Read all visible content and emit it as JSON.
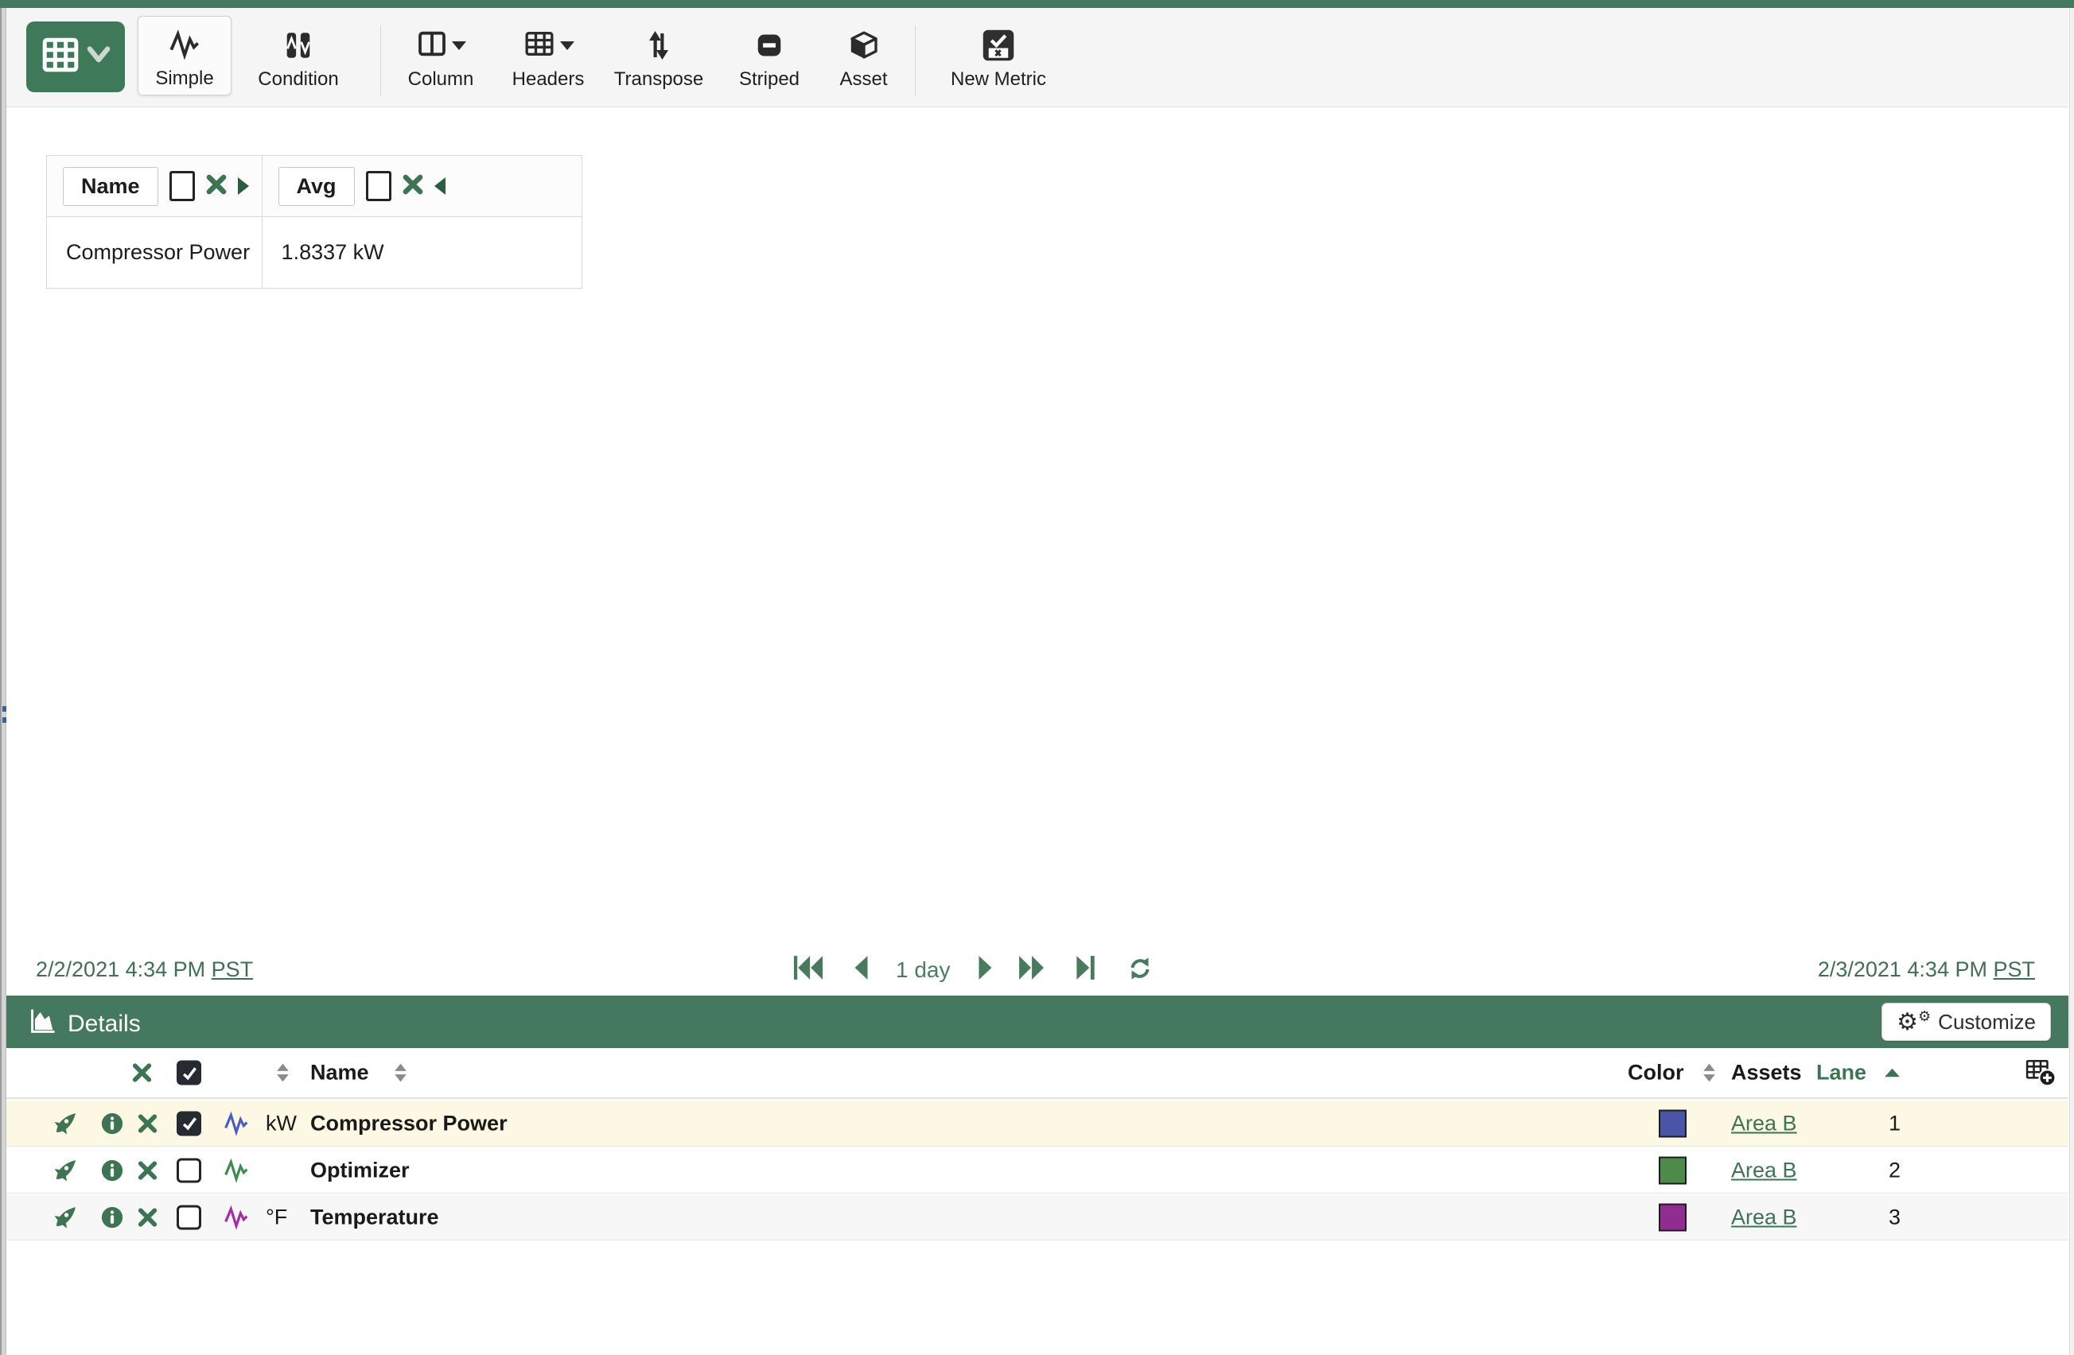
{
  "colors": {
    "brand_green": "#45795f",
    "button_green": "#3e7a5a",
    "icon_green": "#3c7454",
    "date_green": "#3f6f57",
    "selected_row_bg": "#fcf8e3",
    "swatch_compressor_power": "#4a55a8",
    "swatch_optimizer": "#4d8b4b",
    "swatch_temperature": "#912d91",
    "signal_compressor_power": "#4b5cc4",
    "signal_optimizer": "#3e8a4d",
    "signal_temperature": "#a62ba6"
  },
  "toolbar": {
    "buttons": {
      "simple": "Simple",
      "condition": "Condition",
      "column": "Column",
      "headers": "Headers",
      "transpose": "Transpose",
      "striped": "Striped",
      "asset": "Asset",
      "new_metric": "New Metric"
    }
  },
  "summary_table": {
    "name_header": "Name",
    "avg_header": "Avg",
    "rows": [
      {
        "name": "Compressor Power",
        "avg": "1.8337 kW"
      }
    ]
  },
  "timebar": {
    "start": "2/2/2021 4:34 PM",
    "start_tz": "PST",
    "duration": "1 day",
    "end": "2/3/2021 4:34 PM",
    "end_tz": "PST"
  },
  "details": {
    "title": "Details",
    "customize": "Customize",
    "header": {
      "name": "Name",
      "color": "Color",
      "assets": "Assets",
      "lane": "Lane"
    },
    "rows": [
      {
        "unit": "kW",
        "name": "Compressor Power",
        "asset": "Area B",
        "lane": "1",
        "selected": true,
        "checked": true
      },
      {
        "unit": "",
        "name": "Optimizer",
        "asset": "Area B",
        "lane": "2",
        "selected": false,
        "checked": false
      },
      {
        "unit": "°F",
        "name": "Temperature",
        "asset": "Area B",
        "lane": "3",
        "selected": false,
        "checked": false
      }
    ]
  }
}
